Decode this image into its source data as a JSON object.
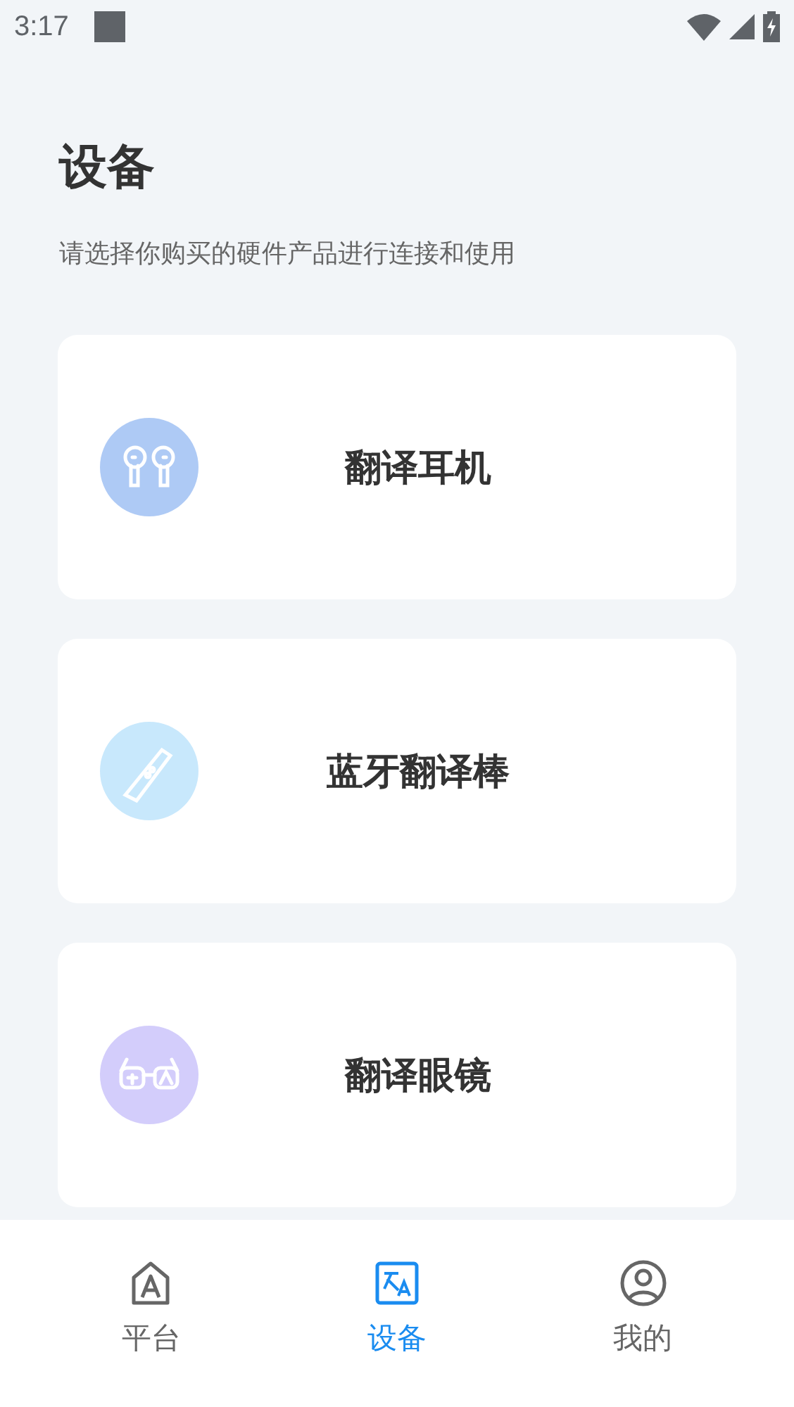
{
  "status_bar": {
    "time": "3:17"
  },
  "header": {
    "title": "设备",
    "subtitle": "请选择你购买的硬件产品进行连接和使用"
  },
  "devices": [
    {
      "kind": "earbuds",
      "name": "翻译耳机",
      "color": "#aecaf5"
    },
    {
      "kind": "pen",
      "name": "蓝牙翻译棒",
      "color": "#c8e8fc"
    },
    {
      "kind": "glasses",
      "name": "翻译眼镜",
      "color": "#d3cdfb"
    }
  ],
  "tabs": [
    {
      "kind": "platform",
      "label": "平台",
      "selected": false
    },
    {
      "kind": "translate",
      "label": "设备",
      "selected": true
    },
    {
      "kind": "profile",
      "label": "我的",
      "selected": false
    }
  ]
}
